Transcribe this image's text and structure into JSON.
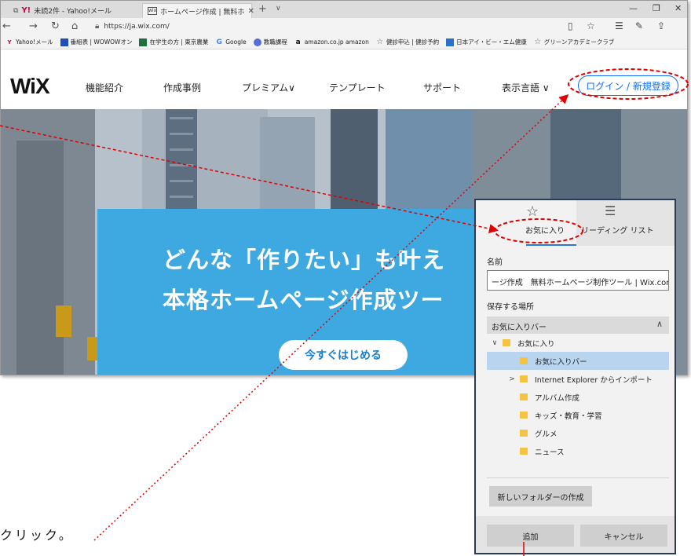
{
  "browser": {
    "tab_inactive": "未読2件 - Yahoo!メール",
    "tab_active": "ホームページ作成 | 無料ホ",
    "tab_active_icon_text": "wix",
    "url": "https://ja.wix.com/",
    "favorites_bar": [
      {
        "label": "Yahoo!メール",
        "icon": "yahoo-icon",
        "color": "#d2003a"
      },
      {
        "label": "番組表 | WOWOWオン",
        "icon": "wowow-icon",
        "color": "#1f4fb8"
      },
      {
        "label": "在学生の方 | 東京農業",
        "icon": "univ-icon",
        "color": "#1d6f3d"
      },
      {
        "label": "Google",
        "icon": "google-icon",
        "color": "#4285f4"
      },
      {
        "label": "教職課程",
        "icon": "globe-icon",
        "color": "#5a6fd6"
      },
      {
        "label": "amazon.co.jp amazon",
        "icon": "amazon-icon",
        "color": "#111111"
      },
      {
        "label": "健診申込 | 健診予約",
        "icon": "star-icon",
        "color": "#666666"
      },
      {
        "label": "日本アイ・ビー・エム健康",
        "icon": "ibm-icon",
        "color": "#2a72c8"
      },
      {
        "label": "グリーンアカデミークラブ",
        "icon": "star-icon",
        "color": "#666666"
      }
    ]
  },
  "wix": {
    "logo": "WiX",
    "nav": [
      "機能紹介",
      "作成事例",
      "プレミアム∨",
      "テンプレート",
      "サポート",
      "表示言語 ∨"
    ],
    "login_button": "ログイン / 新規登録",
    "hero_line1": "どんな「作りたい」も叶え",
    "hero_line2": "本格ホームページ作成ツー",
    "cta": "今すぐはじめる",
    "brand_color": "#116dff",
    "hero_color": "#3ea9e1"
  },
  "panel": {
    "tab_favorites": "お気に入り",
    "tab_reading": "リーディング リスト",
    "name_label": "名前",
    "name_value": "ージ作成　無料ホームページ制作ツール | Wix.com",
    "save_label": "保存する場所",
    "location": "お気に入りバー",
    "tree": [
      {
        "label": "お気に入り",
        "chevron": "∨",
        "indent": 0,
        "selected": false
      },
      {
        "label": "お気に入りバー",
        "chevron": "",
        "indent": 1,
        "selected": true
      },
      {
        "label": "Internet Explorer からインポート",
        "chevron": ">",
        "indent": 1,
        "selected": false
      },
      {
        "label": "アルバム作成",
        "chevron": "",
        "indent": 1,
        "selected": false
      },
      {
        "label": "キッズ・教育・学習",
        "chevron": "",
        "indent": 1,
        "selected": false
      },
      {
        "label": "グルメ",
        "chevron": "",
        "indent": 1,
        "selected": false
      },
      {
        "label": "ニュース",
        "chevron": "",
        "indent": 1,
        "selected": false
      }
    ],
    "new_folder": "新しいフォルダーの作成",
    "add": "追加",
    "cancel": "キャンセル"
  },
  "annotation": {
    "click_text": "クリック。",
    "color": "#e00000"
  }
}
